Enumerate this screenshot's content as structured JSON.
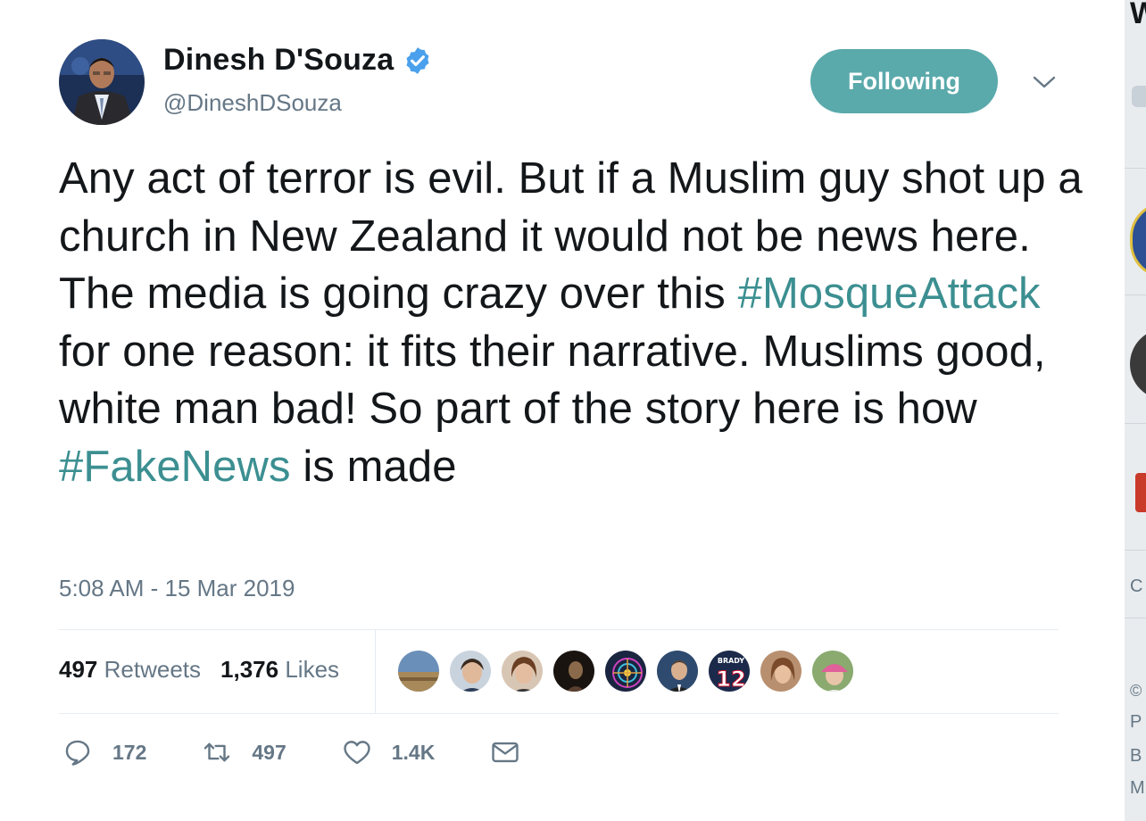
{
  "user": {
    "display_name": "Dinesh D'Souza",
    "handle": "@DineshDSouza",
    "verified": true
  },
  "follow_button": {
    "label": "Following"
  },
  "tweet": {
    "text_parts": [
      "Any act of terror is evil. But if a Muslim guy shot up a church in New Zealand it would not be news here. The media is going crazy over this ",
      "#MosqueAttack",
      " for one reason: it fits their narrative. Muslims good, white man bad! So part of the story here is how ",
      "#FakeNews",
      " is made"
    ],
    "timestamp": "5:08 AM - 15 Mar 2019"
  },
  "stats": {
    "retweets_count": "497",
    "retweets_label": "Retweets",
    "likes_count": "1,376",
    "likes_label": "Likes"
  },
  "likers": {
    "jersey_number": "12",
    "jersey_name": "BRADY"
  },
  "actions": {
    "reply_count": "172",
    "retweet_count": "497",
    "like_count": "1.4K"
  },
  "colors": {
    "follow_button": "#5aa9ab",
    "hashtag": "#3c8f91",
    "verified_badge": "#4aa0ec",
    "muted_text": "#657786"
  },
  "sidebar_fragments": {
    "top": "W",
    "c1": "C",
    "c2": "©",
    "p": "P",
    "b": "B",
    "m": "M"
  }
}
